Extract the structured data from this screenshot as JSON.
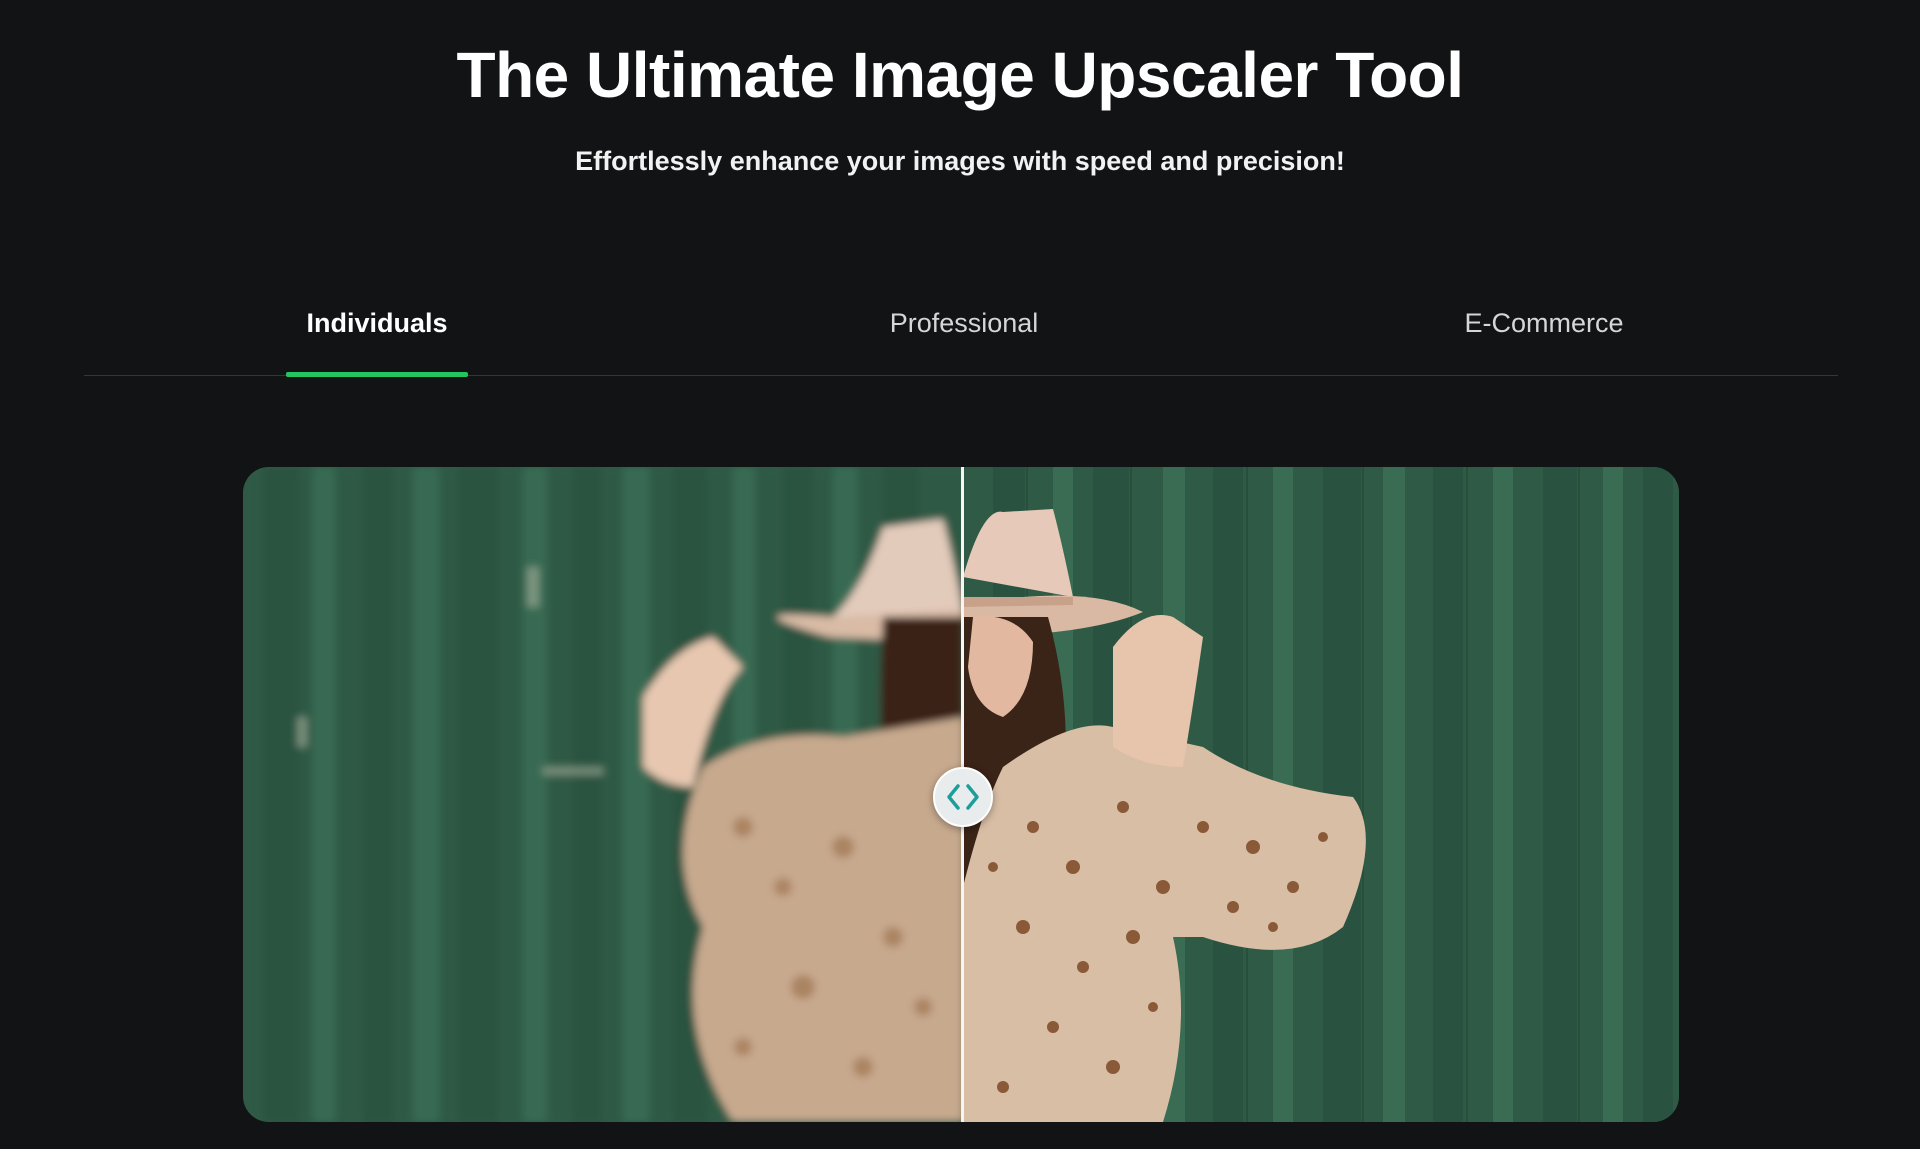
{
  "hero": {
    "title": "The Ultimate Image Upscaler Tool",
    "subtitle": "Effortlessly enhance your images with speed and precision!"
  },
  "tabs": [
    {
      "label": "Individuals",
      "active": true
    },
    {
      "label": "Professional",
      "active": false
    },
    {
      "label": "E-Commerce",
      "active": false
    }
  ],
  "comparison": {
    "slider_position": 0.5,
    "before": "blurry-low-resolution-photo",
    "after": "sharp-upscaled-photo",
    "handle_icon": "chevron-left-right-icon"
  },
  "colors": {
    "background": "#121314",
    "accent": "#22c55e",
    "handle_arrows": "#1e9e9a",
    "wall_green": "#2f5a45"
  }
}
